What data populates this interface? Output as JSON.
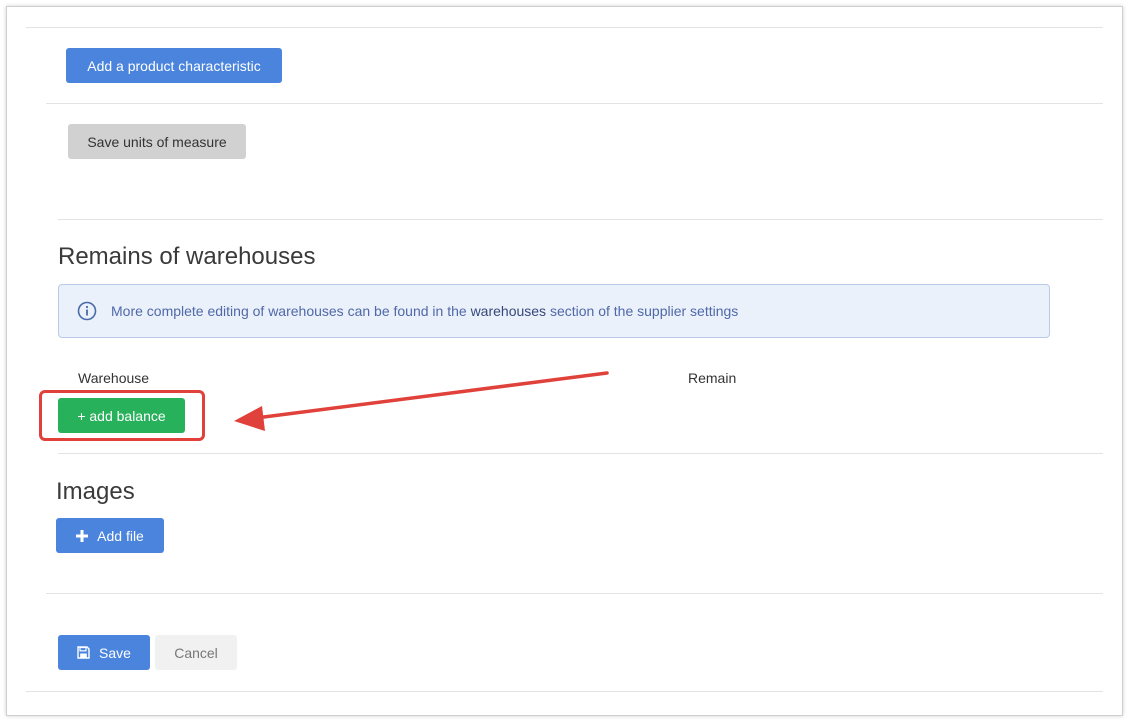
{
  "characteristics": {
    "add_label": "Add a product characteristic"
  },
  "units": {
    "save_label": "Save units of measure"
  },
  "warehouses": {
    "title": "Remains of warehouses",
    "info_prefix": "More complete editing of warehouses can be found in the",
    "info_link": "warehouses",
    "info_suffix": "section of the supplier settings",
    "col_warehouse": "Warehouse",
    "col_remain": "Remain",
    "add_balance_label": "+ add balance"
  },
  "images": {
    "title": "Images",
    "add_file_label": "Add file"
  },
  "form": {
    "save_label": "Save",
    "cancel_label": "Cancel"
  },
  "colors": {
    "primary": "#4a84dd",
    "success": "#28b15b",
    "annotation": "#e0413a",
    "info_bg": "#eaf1fb"
  },
  "icons": {
    "info": "info-circle-icon",
    "plus": "plus-icon",
    "save": "floppy-disk-icon",
    "arrow": "annotation-arrow"
  }
}
